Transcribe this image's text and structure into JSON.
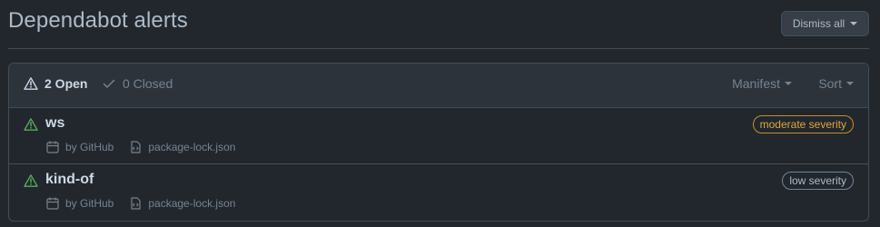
{
  "header": {
    "title": "Dependabot alerts",
    "dismiss_all_label": "Dismiss all"
  },
  "states": {
    "open_label": "2 Open",
    "closed_label": "0 Closed"
  },
  "filters": {
    "manifest_label": "Manifest",
    "sort_label": "Sort"
  },
  "alerts": [
    {
      "package": "ws",
      "source": "by GitHub",
      "manifest": "package-lock.json",
      "severity": "moderate severity"
    },
    {
      "package": "kind-of",
      "source": "by GitHub",
      "manifest": "package-lock.json",
      "severity": "low severity"
    }
  ],
  "colors": {
    "background": "#22272e",
    "header_background": "#2d333b",
    "border": "#444c56",
    "alert_icon": "#57ab5a",
    "moderate": "#c69026"
  },
  "icons": {
    "alert": "alert-icon",
    "check": "check-icon",
    "calendar": "calendar-icon",
    "file_code": "file-code-icon"
  }
}
